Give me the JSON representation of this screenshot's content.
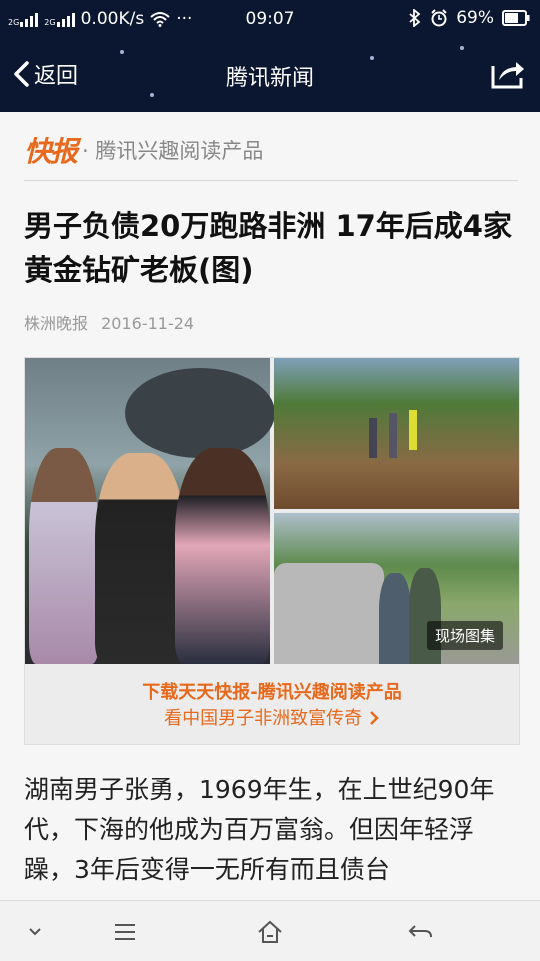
{
  "status_bar": {
    "network_small_1": "2G",
    "network_small_2": "2G",
    "speed": "0.00K/s",
    "dots": "···",
    "time": "09:07",
    "battery": "69%"
  },
  "nav": {
    "back_label": "返回",
    "title": "腾讯新闻"
  },
  "brand": {
    "logo_text": "快报",
    "subtitle": "· 腾讯兴趣阅读产品"
  },
  "article": {
    "headline": "男子负债20万跑路非洲 17年后成4家黄金钻矿老板(图)",
    "source": "株洲晚报",
    "date": "2016-11-24",
    "gallery_badge": "现场图集",
    "promo_line1": "下载天天快报-腾讯兴趣阅读产品",
    "promo_line2": "看中国男子非洲致富传奇",
    "body_text": "湖南男子张勇，1969年生，在上世纪90年代，下海的他成为百万富翁。但因年轻浮躁，3年后变得一无所有而且债台"
  },
  "colors": {
    "header_bg": "#0b1730",
    "accent": "#e8691c"
  },
  "icons": [
    "signal-icon",
    "wifi-icon",
    "bluetooth-icon",
    "alarm-icon",
    "battery-icon",
    "back-chevron-icon",
    "share-icon",
    "down-chevron-icon",
    "menu-icon",
    "home-icon",
    "return-icon"
  ]
}
